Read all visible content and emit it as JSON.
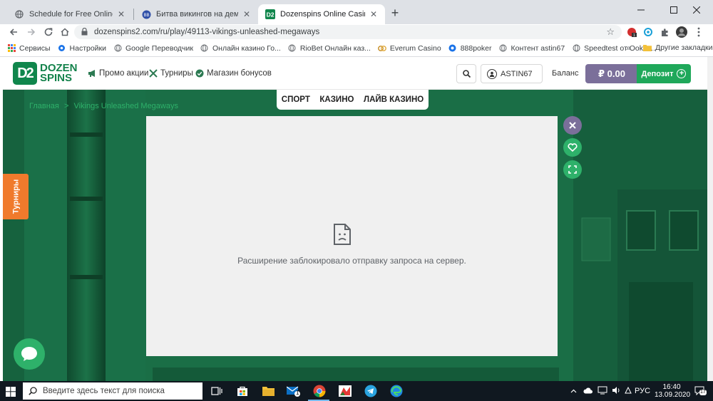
{
  "browser": {
    "tabs": [
      {
        "title": "Schedule for Free Online Video S",
        "icon": "globe-icon"
      },
      {
        "title": "Битва викингов на демо Dozen",
        "icon": "site-favicon"
      },
      {
        "title": "Dozenspins Online Casino",
        "icon": "dozenspins-favicon",
        "active": true
      }
    ],
    "new_tab_label": "+",
    "url": "dozenspins2.com/ru/play/49113-vikings-unleashed-megaways",
    "bookmarks": [
      {
        "label": "Сервисы",
        "icon": "apps-icon"
      },
      {
        "label": "Настройки",
        "icon": "gear-icon"
      },
      {
        "label": "Google Переводчик",
        "icon": "globe-icon"
      },
      {
        "label": "Онлайн казино Го...",
        "icon": "globe-icon"
      },
      {
        "label": "RioBet Онлайн каз...",
        "icon": "globe-icon"
      },
      {
        "label": "Everum Casino",
        "icon": "everum-icon"
      },
      {
        "label": "888poker",
        "icon": "888-icon"
      },
      {
        "label": "Контент astin67",
        "icon": "globe-icon"
      },
      {
        "label": "Speedtest от Ookla...",
        "icon": "globe-icon"
      }
    ],
    "bookmarks_more": "»",
    "other_bookmarks": "Другие закладки"
  },
  "site": {
    "logo": {
      "mark": "D2",
      "line1": "DOZEN",
      "line2": "SPINS"
    },
    "nav": [
      {
        "label": "Промо акции",
        "icon": "megaphone-icon"
      },
      {
        "label": "Турниры",
        "icon": "swords-icon"
      },
      {
        "label": "Магазин бонусов",
        "icon": "check-badge-icon"
      }
    ],
    "username": "ASTIN67",
    "balance_label": "Баланс",
    "balance_value": "₽ 0.00",
    "deposit_label": "Депозит",
    "sub_nav": [
      "СПОРТ",
      "КАЗИНО",
      "ЛАЙВ КАЗИНО"
    ],
    "breadcrumb": {
      "home": "Главная",
      "sep": ">",
      "current": "Vikings Unleashed Megaways"
    },
    "error_message": "Расширение заблокировало отправку запроса на сервер.",
    "tournaments_tab": "Турниры",
    "colors": {
      "brand_green": "#1fa85a",
      "balance_purple": "#7b6f9a",
      "tourn_orange": "#f07a2c",
      "side_green": "#2eb16a"
    }
  },
  "taskbar": {
    "search_placeholder": "Введите здесь текст для поиска",
    "mail_badge": "1",
    "lang": "РУС",
    "time": "16:40",
    "date": "13.09.2020",
    "notifications": "17"
  }
}
